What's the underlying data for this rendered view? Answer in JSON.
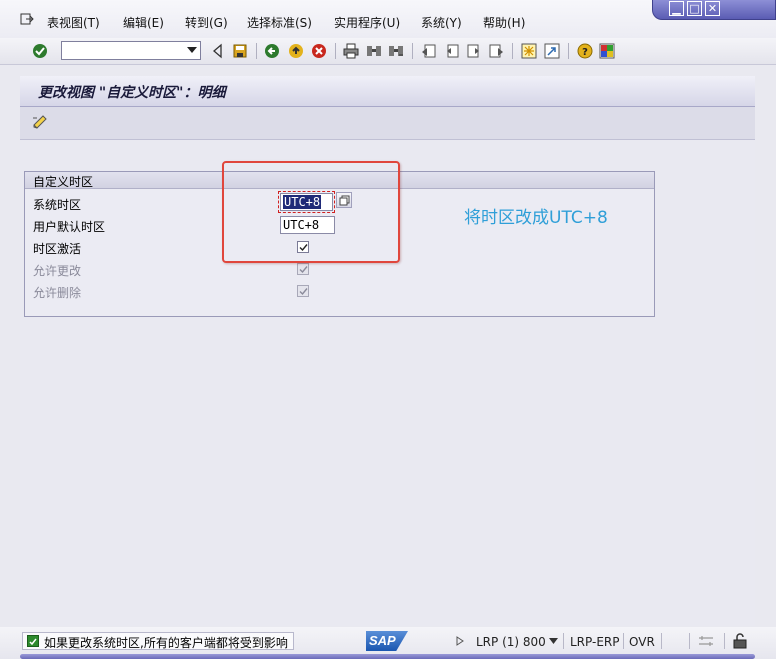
{
  "menu": {
    "items": [
      "表视图(T)",
      "编辑(E)",
      "转到(G)",
      "选择标准(S)",
      "实用程序(U)",
      "系统(Y)",
      "帮助(H)"
    ]
  },
  "toolbar": {
    "command_value": "",
    "icons": [
      "enter-icon",
      "back-arrow-icon",
      "save-icon",
      "back-icon",
      "exit-icon",
      "cancel-icon",
      "print-icon",
      "find-icon",
      "find-next-icon",
      "first-page-icon",
      "prev-page-icon",
      "next-page-icon",
      "last-page-icon",
      "new-session-icon",
      "shortcut-icon",
      "help-icon",
      "layout-icon"
    ]
  },
  "page": {
    "title": "更改视图 \"自定义时区\"：明细"
  },
  "group": {
    "title": "自定义时区",
    "system_tz_label": "系统时区",
    "system_tz_value": "UTC+8",
    "user_tz_label": "用户默认时区",
    "user_tz_value": "UTC+8",
    "active_label": "时区激活",
    "active_checked": true,
    "allow_change_label": "允许更改",
    "allow_change_checked": true,
    "allow_delete_label": "允许删除",
    "allow_delete_checked": true
  },
  "annotation": {
    "text": "将时区改成UTC+8",
    "color": "#2f9fd8",
    "box_color": "#e0463c"
  },
  "status": {
    "message": "如果更改系统时区,所有的客户端都将受到影响",
    "sap_logo": "SAP",
    "system": "LRP (1) 800",
    "server": "LRP-ERP",
    "mode": "OVR"
  }
}
